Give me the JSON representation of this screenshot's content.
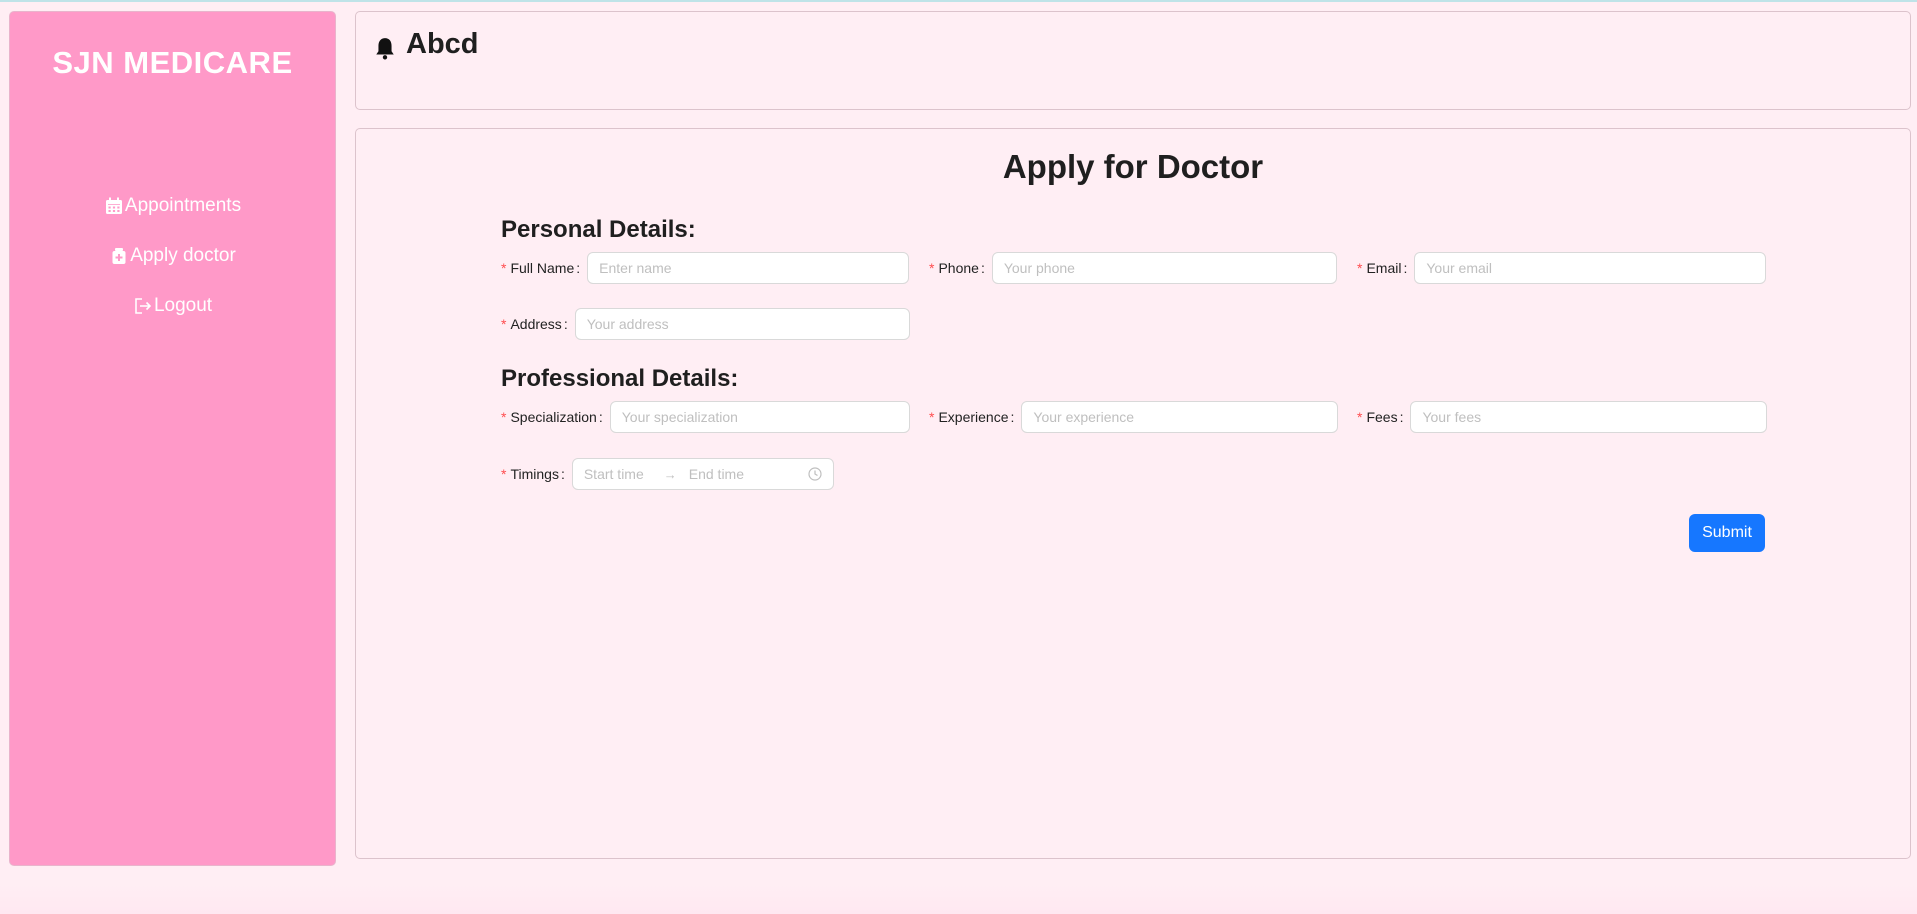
{
  "sidebar": {
    "brand": "SJN MEDICARE",
    "items": [
      {
        "label": "Appointments",
        "icon": "calendar-icon"
      },
      {
        "label": "Apply doctor",
        "icon": "medical-bag-icon"
      },
      {
        "label": "Logout",
        "icon": "logout-icon"
      }
    ]
  },
  "header": {
    "username": "Abcd",
    "icon": "bell-icon"
  },
  "form": {
    "title": "Apply for Doctor",
    "personal_title": "Personal Details:",
    "professional_title": "Professional Details:",
    "fields": {
      "full_name": {
        "label": "Full Name",
        "placeholder": "Enter name"
      },
      "phone": {
        "label": "Phone",
        "placeholder": "Your phone"
      },
      "email": {
        "label": "Email",
        "placeholder": "Your email"
      },
      "address": {
        "label": "Address",
        "placeholder": "Your address"
      },
      "specialization": {
        "label": "Specialization",
        "placeholder": "Your specialization"
      },
      "experience": {
        "label": "Experience",
        "placeholder": "Your experience"
      },
      "fees": {
        "label": "Fees",
        "placeholder": "Your fees"
      },
      "timings": {
        "label": "Timings",
        "start_placeholder": "Start time",
        "end_placeholder": "End time"
      }
    },
    "required_mark": "*",
    "colon": ":",
    "submit_label": "Submit"
  },
  "colors": {
    "sidebar_bg": "#ff99c8",
    "page_bg": "#ffeef4",
    "primary": "#1677ff",
    "required": "#ff4d4f"
  }
}
